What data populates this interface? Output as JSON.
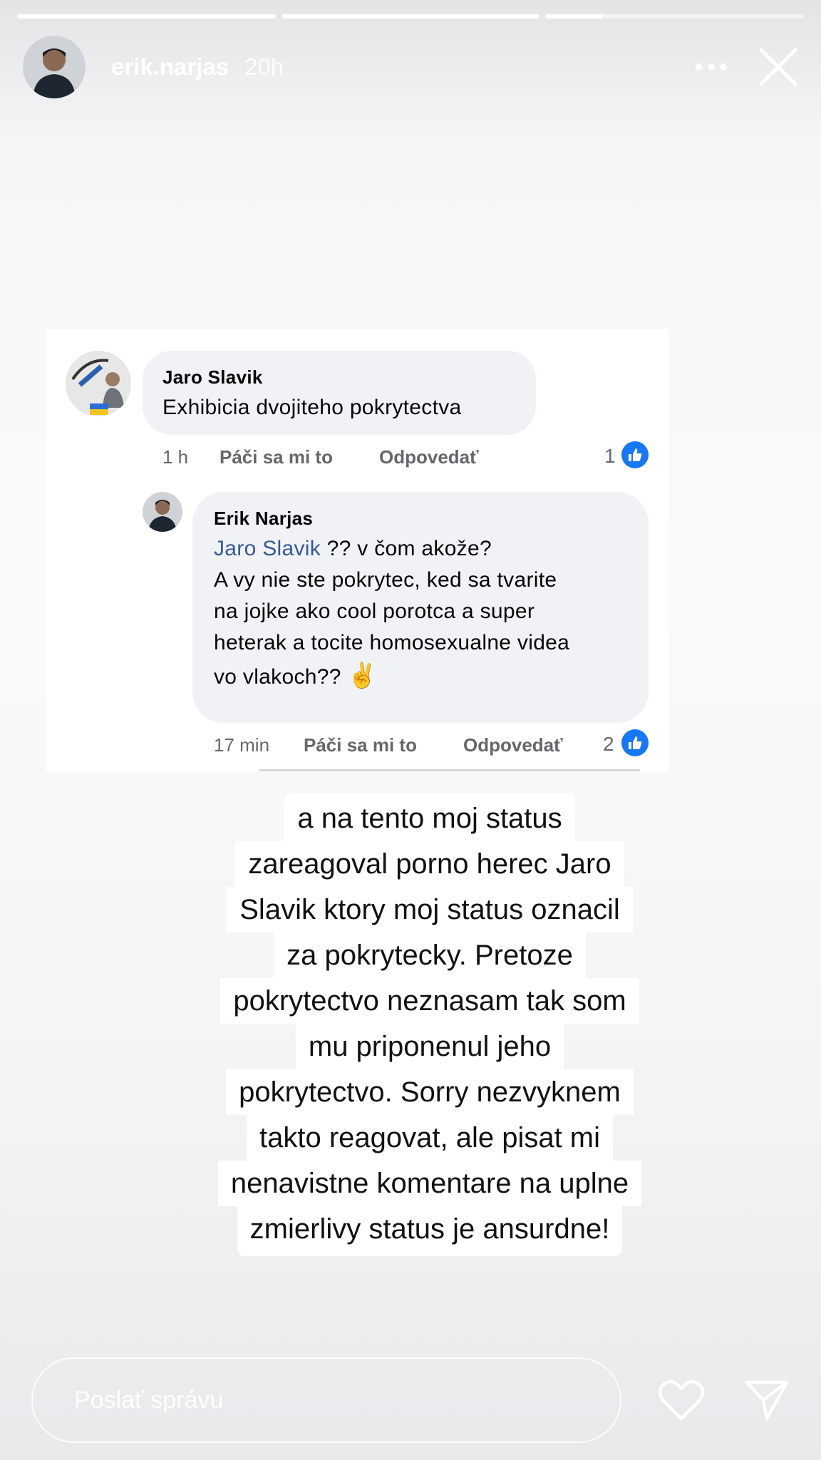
{
  "story": {
    "progress": [
      1.0,
      1.0,
      0.22
    ],
    "username": "erik.narjas",
    "time": "20h"
  },
  "post": {
    "comment1": {
      "author": "Jaro Slavik",
      "text": "Exhibicia dvojiteho pokrytectva",
      "time": "1 h",
      "like_label": "Páči sa mi to",
      "reply_label": "Odpovedať",
      "likes": "1"
    },
    "comment2": {
      "author": "Erik Narjas",
      "mention": "Jaro Slavik",
      "line1_rest": " ?? v čom akože?",
      "line2": "A vy nie ste pokrytec, ked sa tvarite",
      "line3": "na jojke ako cool porotca a super",
      "line4": "heterak a tocite homosexualne videa",
      "line5": "vo vlakoch?? ",
      "emoji": "✌️",
      "time": "17 min",
      "like_label": "Páči sa mi to",
      "reply_label": "Odpovedať",
      "likes": "2"
    }
  },
  "overlay_text": [
    "a na tento moj status",
    "zareagoval porno herec Jaro",
    "Slavik ktory moj status oznacil",
    "za pokrytecky. Pretoze",
    "pokrytectvo neznasam tak som",
    "mu priponenul jeho",
    "pokrytectvo. Sorry nezvyknem",
    "takto reagovat, ale pisat mi",
    "nenavistne komentare na uplne",
    "zmierlivy status je ansurdne!"
  ],
  "footer": {
    "message_placeholder": "Poslať správu"
  },
  "colors": {
    "facebook_blue": "#1877f2",
    "mention_blue": "#385898",
    "bubble_gray": "#f0f2f5"
  },
  "icons": [
    "more-icon",
    "close-icon",
    "like-thumb-icon",
    "heart-icon",
    "send-icon"
  ]
}
